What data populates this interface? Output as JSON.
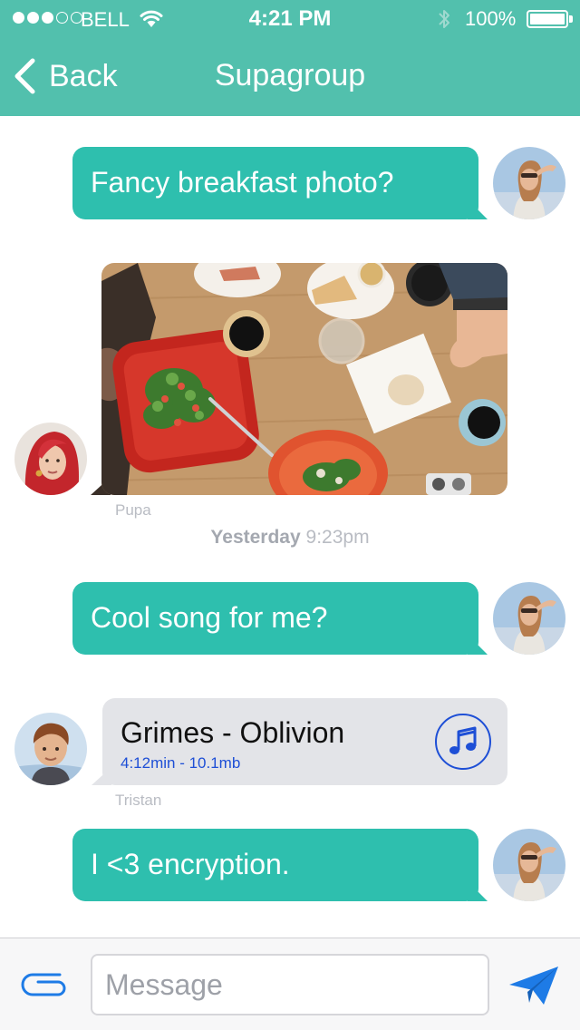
{
  "status_bar": {
    "carrier": "BELL",
    "time": "4:21 PM",
    "battery": "100%",
    "signal_bars": 3,
    "signal_max": 5
  },
  "nav": {
    "back_label": "Back",
    "title": "Supagroup"
  },
  "messages": [
    {
      "type": "outgoing-text",
      "text": "Fancy breakfast photo?"
    },
    {
      "type": "incoming-photo",
      "sender": "Pupa"
    },
    {
      "type": "outgoing-text",
      "text": "Cool song for me?"
    },
    {
      "type": "incoming-audio",
      "sender": "Tristan",
      "title": "Grimes - Oblivion",
      "meta": "4:12min - 10.1mb"
    },
    {
      "type": "outgoing-text",
      "text": "I <3 encryption."
    }
  ],
  "timestamp": {
    "day": "Yesterday",
    "time": "9:23pm"
  },
  "composer": {
    "placeholder": "Message",
    "attach_icon": "paperclip-icon",
    "send_icon": "paper-plane-icon"
  },
  "colors": {
    "header": "#52c0ad",
    "outgoing_bubble": "#2ebfae",
    "incoming_bubble": "#e3e4e8",
    "accent_blue": "#1e4fd6"
  }
}
